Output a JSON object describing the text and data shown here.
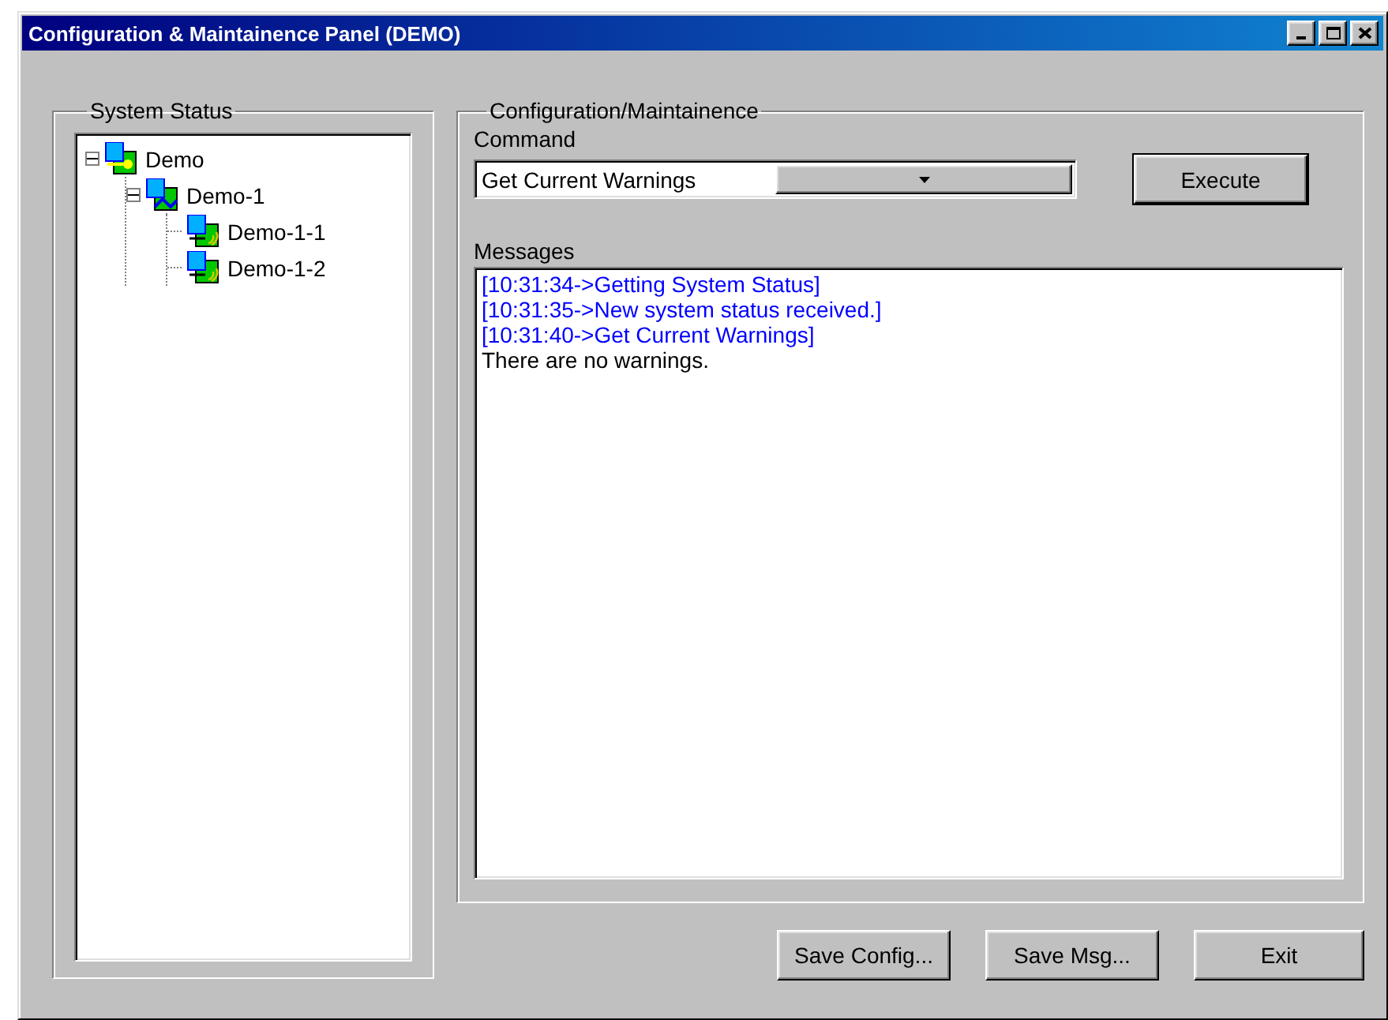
{
  "window": {
    "title": "Configuration & Maintainence Panel (DEMO)"
  },
  "system_status": {
    "title": "System Status",
    "tree": [
      {
        "label": "Demo",
        "kind": "m",
        "expanded": true,
        "children": [
          {
            "label": "Demo-1",
            "kind": "e",
            "expanded": true,
            "children": [
              {
                "label": "Demo-1-1",
                "kind": "r"
              },
              {
                "label": "Demo-1-2",
                "kind": "r"
              }
            ]
          }
        ]
      }
    ]
  },
  "configuration": {
    "title": "Configuration/Maintainence",
    "command_label": "Command",
    "command_value": "Get Current Warnings",
    "execute_button": "Execute",
    "messages_label": "Messages",
    "messages": [
      {
        "text": "[10:31:34->Getting System Status]",
        "kind": "log"
      },
      {
        "text": "[10:31:35->New system status received.]",
        "kind": "log"
      },
      {
        "text": "[10:31:40->Get Current Warnings]",
        "kind": "log"
      },
      {
        "text": "There are no warnings.",
        "kind": "result"
      }
    ]
  },
  "buttons": [
    "Save Config...",
    "Save Msg...",
    "Exit"
  ]
}
